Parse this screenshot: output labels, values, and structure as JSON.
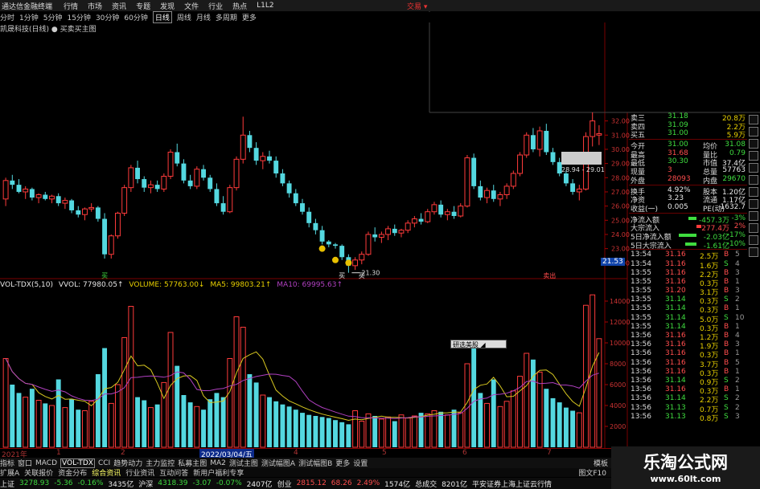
{
  "app": {
    "title": "通达信金融终端",
    "trade_button": "交易 ▾"
  },
  "menu": [
    "行情",
    "市场",
    "资讯",
    "专题",
    "发现",
    "文件",
    "行业",
    "热点",
    "L1L2"
  ],
  "periods": {
    "items": [
      "分时",
      "1分钟",
      "5分钟",
      "15分钟",
      "30分钟",
      "60分钟",
      "日线",
      "周线",
      "月线",
      "多周期",
      "更多"
    ],
    "active": "日线"
  },
  "stock": {
    "header": "凯晟科技(日线)  ● 买卖买主图"
  },
  "price_axis": [
    "32.00",
    "31.00",
    "30.00",
    "29.00",
    "28.00",
    "27.00",
    "26.00",
    "25.00",
    "24.00",
    "23.00",
    "22.00"
  ],
  "vol_axis": [
    "14000",
    "12000",
    "10000",
    "8000",
    "6000",
    "4000",
    "2000"
  ],
  "chart_labels": {
    "low_mark": "21.30",
    "current": "21.53",
    "range": "28.94 - 29.01",
    "sell_mark": "卖出",
    "buy_mark_1": "买",
    "buy_mark_2": "买",
    "buy_mark_3": "买"
  },
  "vol_header": {
    "name": "VOL-TDX(5,10)",
    "vvol": "VVOL: 77980.05↑",
    "volume": "VOLUME: 57763.00↓",
    "ma5": "MA5: 99803.21↑",
    "ma10": "MA10: 69995.63↑"
  },
  "popup": "研选美股 ◢",
  "quote": {
    "top": [
      {
        "l": "卖三",
        "v": "31.18",
        "v2": "20.8万"
      },
      {
        "l": "卖四",
        "v": "31.09",
        "v2": "2.2万"
      },
      {
        "l": "买五",
        "v": "31.00",
        "v2": "5.9万"
      }
    ],
    "stats": [
      {
        "l": "今开",
        "v": "31.00",
        "l2": "均价",
        "v2": "31.08"
      },
      {
        "l": "最高",
        "v": "31.68",
        "l2": "量比",
        "v2": "0.79"
      },
      {
        "l": "最低",
        "v": "30.30",
        "l2": "市值",
        "v2": "37.4亿"
      },
      {
        "l": "现量",
        "v": "3",
        "l2": "总量",
        "v2": "57763"
      },
      {
        "l": "外盘",
        "v": "28093",
        "l2": "内盘",
        "v2": "29670"
      },
      {
        "l": "换手",
        "v": "4.92%",
        "l2": "股本",
        "v2": "1.20亿"
      },
      {
        "l": "净资",
        "v": "3.23",
        "l2": "流通",
        "v2": "1.17亿"
      },
      {
        "l": "收益(一)",
        "v": "0.005",
        "l2": "PE(动)",
        "v2": "1632.7"
      }
    ],
    "flows": [
      {
        "l": "净流入额",
        "v": "-457.3万",
        "p": "-3%"
      },
      {
        "l": "大宗流入",
        "v": "277.4万",
        "p": "2%"
      },
      {
        "l": "5日净流入额",
        "v": "-2.03亿",
        "p": "-17%"
      },
      {
        "l": "5日大宗流入",
        "v": "-1.61亿",
        "p": "-10%"
      }
    ]
  },
  "ticks": [
    {
      "t": "13:54",
      "p": "31.16",
      "v": "2.5万",
      "d": "B",
      "n": "5"
    },
    {
      "t": "13:54",
      "p": "31.16",
      "v": "1.6万",
      "d": "S",
      "n": "4"
    },
    {
      "t": "13:55",
      "p": "31.16",
      "v": "2.2万",
      "d": "B",
      "n": "3"
    },
    {
      "t": "13:55",
      "p": "31.16",
      "v": "0.3万",
      "d": "B",
      "n": "1"
    },
    {
      "t": "13:55",
      "p": "31.20",
      "v": "3.1万",
      "d": "B",
      "n": "3"
    },
    {
      "t": "13:55",
      "p": "31.14",
      "v": "0.3万",
      "d": "S",
      "n": "2"
    },
    {
      "t": "13:55",
      "p": "31.14",
      "v": "0.3万",
      "d": "B",
      "n": "1"
    },
    {
      "t": "13:55",
      "p": "31.14",
      "v": "5.0万",
      "d": "S",
      "n": "10"
    },
    {
      "t": "13:55",
      "p": "31.14",
      "v": "0.3万",
      "d": "B",
      "n": "1"
    },
    {
      "t": "13:56",
      "p": "31.16",
      "v": "1.2万",
      "d": "B",
      "n": "4"
    },
    {
      "t": "13:56",
      "p": "31.16",
      "v": "1.9万",
      "d": "B",
      "n": "3"
    },
    {
      "t": "13:56",
      "p": "31.16",
      "v": "0.3万",
      "d": "B",
      "n": "1"
    },
    {
      "t": "13:56",
      "p": "31.16",
      "v": "3.7万",
      "d": "B",
      "n": "5"
    },
    {
      "t": "13:56",
      "p": "31.16",
      "v": "0.3万",
      "d": "B",
      "n": "1"
    },
    {
      "t": "13:56",
      "p": "31.14",
      "v": "0.9万",
      "d": "S",
      "n": "2"
    },
    {
      "t": "13:56",
      "p": "31.16",
      "v": "0.3万",
      "d": "B",
      "n": "1"
    },
    {
      "t": "13:56",
      "p": "31.14",
      "v": "2.2万",
      "d": "S",
      "n": "2"
    },
    {
      "t": "13:56",
      "p": "31.13",
      "v": "0.7万",
      "d": "S",
      "n": "2"
    },
    {
      "t": "13:56",
      "p": "31.13",
      "v": "0.8万",
      "d": "S",
      "n": "3"
    }
  ],
  "date_axis": {
    "year": "2021年",
    "selected": "2022/03/04/五",
    "ticks": [
      "1",
      "2",
      "3",
      "4",
      "5",
      "6",
      "7"
    ]
  },
  "indicator_tabs": {
    "items": [
      "指标",
      "窗口",
      "MACD",
      "VOL-TDX",
      "CCI",
      "趋势动力",
      "主力监控",
      "私募主图",
      "MA2",
      "测试主图",
      "测试幅图A",
      "测试幅图B",
      "更多",
      "设置"
    ],
    "active": "VOL-TDX",
    "right": "模板"
  },
  "sub_tabs": {
    "items": [
      "扩展A",
      "关联报价",
      "资金分布",
      "综合资讯",
      "行业资讯",
      "互动问答",
      "新用户福利专享"
    ],
    "active": "综合资讯",
    "right": "图文F10"
  },
  "statusbar": [
    {
      "label": "上证",
      "value": "3278.93",
      "chg": "-5.36",
      "pct": "-0.16%",
      "amt": "3435亿"
    },
    {
      "label": "沪深",
      "value": "4318.39",
      "chg": "-3.07",
      "pct": "-0.07%",
      "amt": "2407亿"
    },
    {
      "label": "创业",
      "value": "2815.12",
      "chg": "68.26",
      "pct": "2.49%",
      "amt": "1574亿"
    },
    {
      "label": "总成交",
      "value": "8201亿",
      "chg": "",
      "pct": "",
      "amt": ""
    }
  ],
  "status_right": "平安证券上海上证云行情",
  "watermark": {
    "line1": "乐淘公式网",
    "line2": "www.60lt.com"
  },
  "colors": {
    "up": "#ff3b3b",
    "down": "#54d8e0",
    "ma5": "#d8c820",
    "ma10": "#b040c0",
    "bg": "#000000"
  },
  "chart_data": {
    "type": "candlestick+bar",
    "candles": [
      [
        26.5,
        28.0,
        26.0,
        27.8
      ],
      [
        27.8,
        28.2,
        27.2,
        27.5
      ],
      [
        27.5,
        27.9,
        26.9,
        27.0
      ],
      [
        27.0,
        27.4,
        26.5,
        27.2
      ],
      [
        27.2,
        27.3,
        26.4,
        26.6
      ],
      [
        26.6,
        26.9,
        26.2,
        26.8
      ],
      [
        26.8,
        27.0,
        26.4,
        26.5
      ],
      [
        26.5,
        26.8,
        26.2,
        26.7
      ],
      [
        26.7,
        26.9,
        26.0,
        26.2
      ],
      [
        26.2,
        26.6,
        25.8,
        26.4
      ],
      [
        26.4,
        26.5,
        25.5,
        25.7
      ],
      [
        25.7,
        26.0,
        25.2,
        25.4
      ],
      [
        25.4,
        25.9,
        25.0,
        25.8
      ],
      [
        25.8,
        26.2,
        25.6,
        25.9
      ],
      [
        25.9,
        26.0,
        24.9,
        25.1
      ],
      [
        25.1,
        25.5,
        22.3,
        22.6
      ],
      [
        22.6,
        24.0,
        22.3,
        23.9
      ],
      [
        23.9,
        25.6,
        23.7,
        25.5
      ],
      [
        25.5,
        27.5,
        25.3,
        27.3
      ],
      [
        27.3,
        28.9,
        27.0,
        28.7
      ],
      [
        28.7,
        29.2,
        27.6,
        27.9
      ],
      [
        27.9,
        28.1,
        27.0,
        27.3
      ],
      [
        27.3,
        27.8,
        26.9,
        27.5
      ],
      [
        27.5,
        27.8,
        27.0,
        27.2
      ],
      [
        27.2,
        28.3,
        27.0,
        28.1
      ],
      [
        28.1,
        30.0,
        27.9,
        29.8
      ],
      [
        29.8,
        30.4,
        28.8,
        29.0
      ],
      [
        29.0,
        29.3,
        27.6,
        27.8
      ],
      [
        27.8,
        28.2,
        27.2,
        27.4
      ],
      [
        27.4,
        28.8,
        27.2,
        28.6
      ],
      [
        28.6,
        28.9,
        27.8,
        28.0
      ],
      [
        28.0,
        28.2,
        27.0,
        27.2
      ],
      [
        27.2,
        27.6,
        26.0,
        26.2
      ],
      [
        26.2,
        26.7,
        25.4,
        25.6
      ],
      [
        25.6,
        27.5,
        25.5,
        27.3
      ],
      [
        27.3,
        29.5,
        27.1,
        29.3
      ],
      [
        29.3,
        32.3,
        29.0,
        31.0
      ],
      [
        31.0,
        31.3,
        29.8,
        30.1
      ],
      [
        30.1,
        30.5,
        28.9,
        29.2
      ],
      [
        29.2,
        29.8,
        28.6,
        29.5
      ],
      [
        29.5,
        29.9,
        29.0,
        29.2
      ],
      [
        29.2,
        29.5,
        28.0,
        28.3
      ],
      [
        28.3,
        28.6,
        27.4,
        27.6
      ],
      [
        27.6,
        27.8,
        26.6,
        26.9
      ],
      [
        26.9,
        27.2,
        26.0,
        26.2
      ],
      [
        26.2,
        26.5,
        25.4,
        25.6
      ],
      [
        25.6,
        25.9,
        24.5,
        24.8
      ],
      [
        24.8,
        25.1,
        24.0,
        24.3
      ],
      [
        24.3,
        24.6,
        23.3,
        23.5
      ],
      [
        23.5,
        23.6,
        23.1,
        23.3
      ],
      [
        23.3,
        23.4,
        23.0,
        23.2
      ],
      [
        23.2,
        23.3,
        22.2,
        22.4
      ],
      [
        22.4,
        22.6,
        21.3,
        21.8
      ],
      [
        21.8,
        22.4,
        21.5,
        22.2
      ],
      [
        22.2,
        22.8,
        21.9,
        22.6
      ],
      [
        22.6,
        24.2,
        22.5,
        24.0
      ],
      [
        24.0,
        24.5,
        23.5,
        23.8
      ],
      [
        23.8,
        24.2,
        23.4,
        24.0
      ],
      [
        24.0,
        24.6,
        23.6,
        24.4
      ],
      [
        24.4,
        24.7,
        23.9,
        24.1
      ],
      [
        24.1,
        24.4,
        23.8,
        24.3
      ],
      [
        24.3,
        25.0,
        24.1,
        24.8
      ],
      [
        24.8,
        25.3,
        24.5,
        25.1
      ],
      [
        25.1,
        25.5,
        24.7,
        24.9
      ],
      [
        24.9,
        25.8,
        24.8,
        25.6
      ],
      [
        25.6,
        26.3,
        25.4,
        26.1
      ],
      [
        26.1,
        26.4,
        25.2,
        25.4
      ],
      [
        25.4,
        25.8,
        25.0,
        25.6
      ],
      [
        25.6,
        26.0,
        25.1,
        25.3
      ],
      [
        25.3,
        26.2,
        25.2,
        26.0
      ],
      [
        26.0,
        29.6,
        25.9,
        29.4
      ],
      [
        29.4,
        29.7,
        27.2,
        27.4
      ],
      [
        27.4,
        27.8,
        26.4,
        26.6
      ],
      [
        26.6,
        27.3,
        26.2,
        27.1
      ],
      [
        27.1,
        27.5,
        26.3,
        26.5
      ],
      [
        26.5,
        27.0,
        26.0,
        26.8
      ],
      [
        26.8,
        27.6,
        26.5,
        27.4
      ],
      [
        27.4,
        28.5,
        27.2,
        28.3
      ],
      [
        28.3,
        29.8,
        28.1,
        29.6
      ],
      [
        29.6,
        31.2,
        29.4,
        31.0
      ],
      [
        31.0,
        31.5,
        29.8,
        30.0
      ],
      [
        30.0,
        31.6,
        29.5,
        31.3
      ],
      [
        31.3,
        31.8,
        29.6,
        29.8
      ],
      [
        29.8,
        30.1,
        28.9,
        29.1
      ],
      [
        29.1,
        29.4,
        28.1,
        28.3
      ],
      [
        28.3,
        28.5,
        27.4,
        27.6
      ],
      [
        27.6,
        27.9,
        26.8,
        27.0
      ],
      [
        27.0,
        27.5,
        26.4,
        27.2
      ],
      [
        27.2,
        31.2,
        27.1,
        30.9
      ],
      [
        30.9,
        32.6,
        30.2,
        32.0
      ],
      [
        31.0,
        31.7,
        30.3,
        31.1
      ]
    ],
    "volumes": [
      8500,
      6000,
      5200,
      4800,
      5600,
      4500,
      4200,
      4000,
      6500,
      3800,
      4600,
      3600,
      3500,
      4400,
      7000,
      9500,
      4200,
      6000,
      10500,
      13500,
      4800,
      4500,
      3800,
      4100,
      6200,
      11000,
      7800,
      5000,
      4300,
      3900,
      3600,
      4600,
      5200,
      4800,
      8500,
      12500,
      11500,
      7000,
      6200,
      5000,
      4800,
      4400,
      4100,
      3900,
      3600,
      3300,
      3100,
      3000,
      2900,
      2800,
      2600,
      2400,
      2200,
      3500,
      2500,
      3200,
      3000,
      2700,
      2900,
      2500,
      3100,
      2800,
      3000,
      3300,
      3200,
      3500,
      3400,
      3100,
      3600,
      3300,
      8000,
      9600,
      5200,
      4200,
      6500,
      3900,
      4400,
      5400,
      6800,
      9000,
      8400,
      7200,
      5600,
      4700,
      4300,
      3800,
      3500,
      3300,
      13600,
      14600,
      10400
    ],
    "ylim_price": [
      21.0,
      32.6
    ],
    "ylim_vol": [
      0,
      15000
    ]
  }
}
